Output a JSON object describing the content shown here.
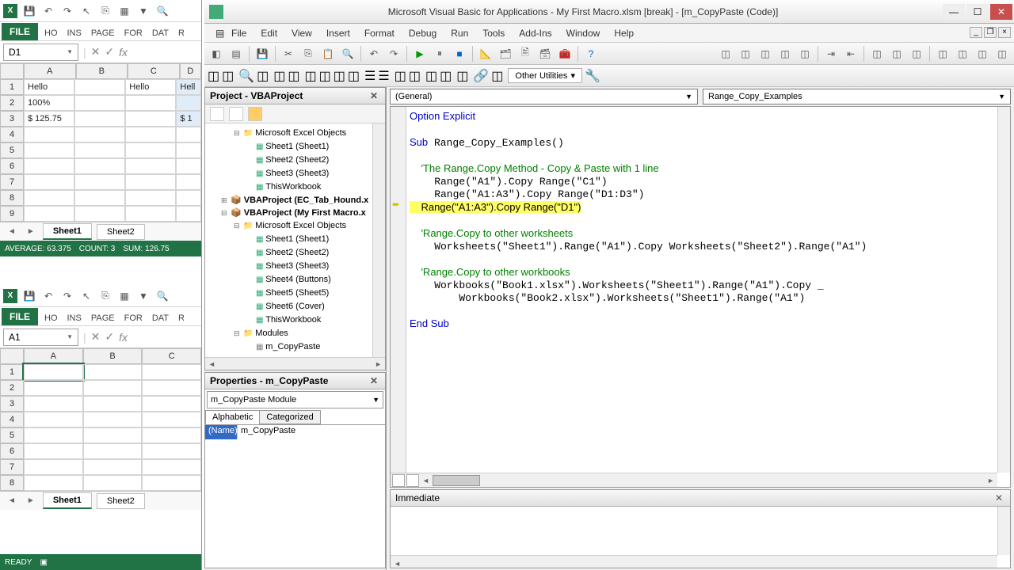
{
  "excel_top": {
    "file_label": "FILE",
    "menu": [
      "HO",
      "INS",
      "PAGE",
      "FOR",
      "DAT",
      "R"
    ],
    "namebox": "D1",
    "columns": [
      "A",
      "B",
      "C",
      "D"
    ],
    "rows": [
      {
        "n": "1",
        "cells": [
          "Hello",
          "",
          "Hello",
          "Hell"
        ]
      },
      {
        "n": "2",
        "cells": [
          "100%",
          "",
          "",
          ""
        ]
      },
      {
        "n": "3",
        "cells": [
          "$ 125.75",
          "",
          "",
          "$ 1"
        ]
      },
      {
        "n": "4",
        "cells": [
          "",
          "",
          "",
          ""
        ]
      },
      {
        "n": "5",
        "cells": [
          "",
          "",
          "",
          ""
        ]
      },
      {
        "n": "6",
        "cells": [
          "",
          "",
          "",
          ""
        ]
      },
      {
        "n": "7",
        "cells": [
          "",
          "",
          "",
          ""
        ]
      },
      {
        "n": "8",
        "cells": [
          "",
          "",
          "",
          ""
        ]
      },
      {
        "n": "9",
        "cells": [
          "",
          "",
          "",
          ""
        ]
      }
    ],
    "sheets": [
      "Sheet1",
      "Sheet2"
    ],
    "active_sheet": 0,
    "status": {
      "avg": "AVERAGE: 63.375",
      "count": "COUNT: 3",
      "sum": "SUM: 126.75"
    }
  },
  "excel_bottom": {
    "file_label": "FILE",
    "menu": [
      "HO",
      "INS",
      "PAGE",
      "FOR",
      "DAT",
      "R"
    ],
    "namebox": "A1",
    "columns": [
      "A",
      "B",
      "C"
    ],
    "rows": [
      {
        "n": "1",
        "cells": [
          "",
          "",
          ""
        ]
      },
      {
        "n": "2",
        "cells": [
          "",
          "",
          ""
        ]
      },
      {
        "n": "3",
        "cells": [
          "",
          "",
          ""
        ]
      },
      {
        "n": "4",
        "cells": [
          "",
          "",
          ""
        ]
      },
      {
        "n": "5",
        "cells": [
          "",
          "",
          ""
        ]
      },
      {
        "n": "6",
        "cells": [
          "",
          "",
          ""
        ]
      },
      {
        "n": "7",
        "cells": [
          "",
          "",
          ""
        ]
      },
      {
        "n": "8",
        "cells": [
          "",
          "",
          ""
        ]
      }
    ],
    "sheets": [
      "Sheet1",
      "Sheet2"
    ],
    "active_sheet": 0,
    "status": {
      "ready": "READY"
    }
  },
  "vbe": {
    "title": "Microsoft Visual Basic for Applications - My First Macro.xlsm [break] - [m_CopyPaste (Code)]",
    "menus": [
      "File",
      "Edit",
      "View",
      "Insert",
      "Format",
      "Debug",
      "Run",
      "Tools",
      "Add-Ins",
      "Window",
      "Help"
    ],
    "other_utilities": "Other Utilities",
    "project": {
      "title": "Project - VBAProject",
      "items": [
        {
          "lvl": 2,
          "type": "folder",
          "exp": "-",
          "label": "Microsoft Excel Objects"
        },
        {
          "lvl": 3,
          "type": "sheet",
          "label": "Sheet1 (Sheet1)"
        },
        {
          "lvl": 3,
          "type": "sheet",
          "label": "Sheet2 (Sheet2)"
        },
        {
          "lvl": 3,
          "type": "sheet",
          "label": "Sheet3 (Sheet3)"
        },
        {
          "lvl": 3,
          "type": "sheet",
          "label": "ThisWorkbook"
        },
        {
          "lvl": 1,
          "type": "proj",
          "exp": "+",
          "label": "VBAProject (EC_Tab_Hound.x"
        },
        {
          "lvl": 1,
          "type": "proj",
          "exp": "-",
          "label": "VBAProject (My First Macro.x"
        },
        {
          "lvl": 2,
          "type": "folder",
          "exp": "-",
          "label": "Microsoft Excel Objects"
        },
        {
          "lvl": 3,
          "type": "sheet",
          "label": "Sheet1 (Sheet1)"
        },
        {
          "lvl": 3,
          "type": "sheet",
          "label": "Sheet2 (Sheet2)"
        },
        {
          "lvl": 3,
          "type": "sheet",
          "label": "Sheet3 (Sheet3)"
        },
        {
          "lvl": 3,
          "type": "sheet",
          "label": "Sheet4 (Buttons)"
        },
        {
          "lvl": 3,
          "type": "sheet",
          "label": "Sheet5 (Sheet5)"
        },
        {
          "lvl": 3,
          "type": "sheet",
          "label": "Sheet6 (Cover)"
        },
        {
          "lvl": 3,
          "type": "sheet",
          "label": "ThisWorkbook"
        },
        {
          "lvl": 2,
          "type": "folder",
          "exp": "-",
          "label": "Modules"
        },
        {
          "lvl": 3,
          "type": "mod",
          "label": "m_CopyPaste"
        }
      ]
    },
    "properties": {
      "title": "Properties - m_CopyPaste",
      "combo": "m_CopyPaste Module",
      "tabs": [
        "Alphabetic",
        "Categorized"
      ],
      "name_label": "(Name)",
      "name_value": "m_CopyPaste"
    },
    "code": {
      "object_combo": "(General)",
      "proc_combo": "Range_Copy_Examples",
      "lines": [
        {
          "t": "Option Explicit",
          "cls": "kw"
        },
        {
          "t": "",
          "cls": ""
        },
        {
          "t": "Sub Range_Copy_Examples()",
          "cls": "kw-mixed"
        },
        {
          "t": "",
          "cls": ""
        },
        {
          "t": "    'The Range.Copy Method - Copy & Paste with 1 line",
          "cls": "cm"
        },
        {
          "t": "    Range(\"A1\").Copy Range(\"C1\")",
          "cls": ""
        },
        {
          "t": "    Range(\"A1:A3\").Copy Range(\"D1:D3\")",
          "cls": ""
        },
        {
          "t": "    Range(\"A1:A3\").Copy Range(\"D1\")",
          "cls": "hl"
        },
        {
          "t": "",
          "cls": ""
        },
        {
          "t": "    'Range.Copy to other worksheets",
          "cls": "cm"
        },
        {
          "t": "    Worksheets(\"Sheet1\").Range(\"A1\").Copy Worksheets(\"Sheet2\").Range(\"A1\")",
          "cls": ""
        },
        {
          "t": "",
          "cls": ""
        },
        {
          "t": "    'Range.Copy to other workbooks",
          "cls": "cm"
        },
        {
          "t": "    Workbooks(\"Book1.xlsx\").Worksheets(\"Sheet1\").Range(\"A1\").Copy _",
          "cls": ""
        },
        {
          "t": "        Workbooks(\"Book2.xlsx\").Worksheets(\"Sheet1\").Range(\"A1\")",
          "cls": ""
        },
        {
          "t": "",
          "cls": ""
        },
        {
          "t": "End Sub",
          "cls": "kw"
        }
      ],
      "break_line_index": 7
    },
    "immediate_title": "Immediate"
  }
}
